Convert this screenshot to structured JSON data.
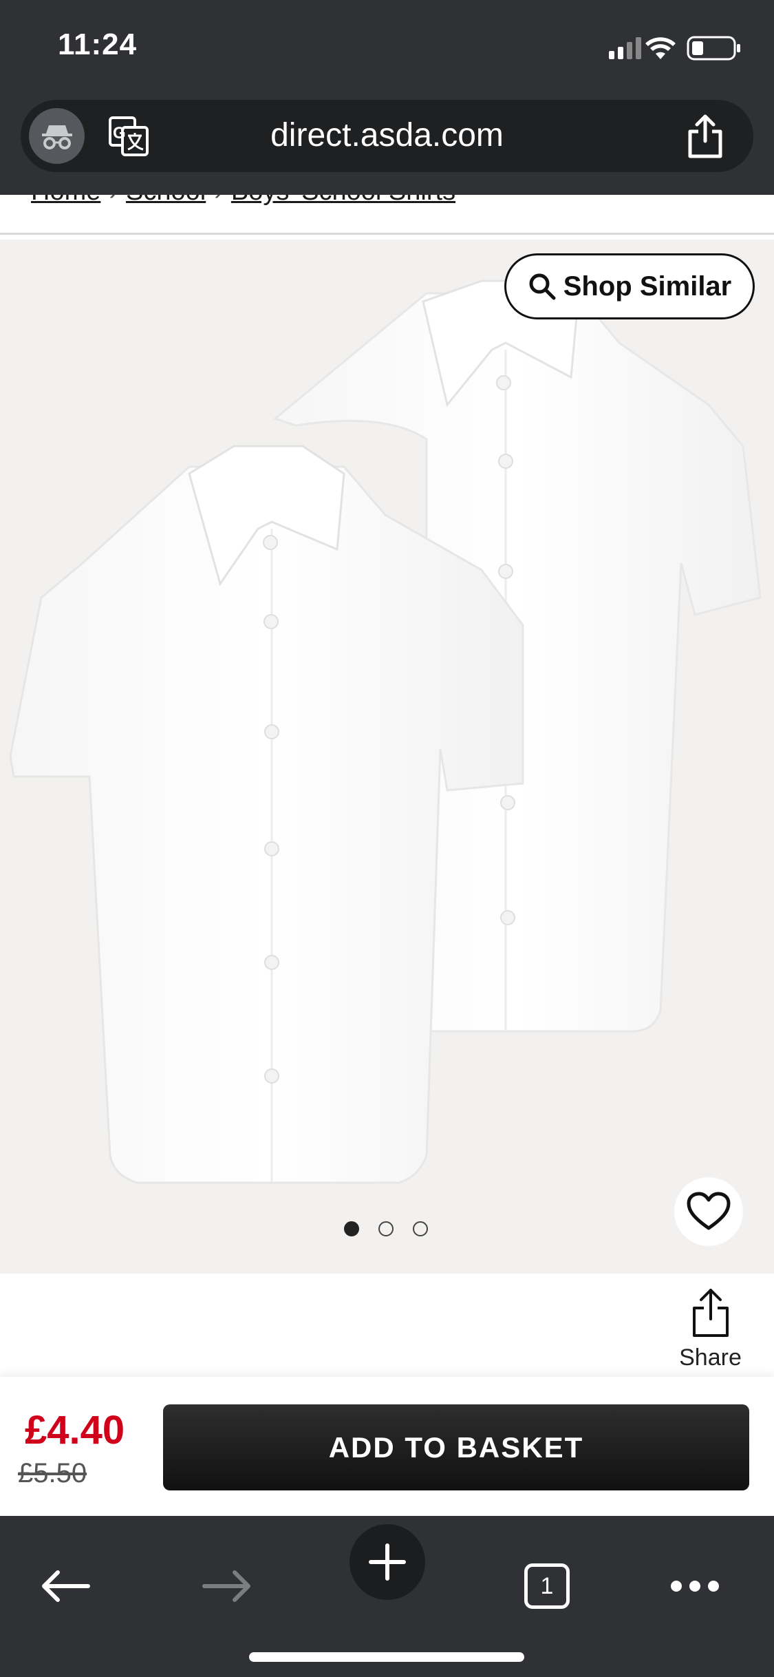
{
  "status_bar": {
    "time": "11:24"
  },
  "browser": {
    "url": "direct.asda.com"
  },
  "breadcrumb": [
    "Home",
    "School",
    "Boys' School Shirts"
  ],
  "product": {
    "shop_similar_label": "Shop Similar",
    "image_dots": {
      "count": 3,
      "active_index": 0
    },
    "share_label": "Share"
  },
  "pricing": {
    "current": "£4.40",
    "was": "£5.50"
  },
  "actions": {
    "add_to_basket": "ADD TO BASKET"
  },
  "toolbar": {
    "tab_count": "1"
  },
  "colors": {
    "price_red": "#d0021b",
    "chrome_dark": "#2f3134"
  }
}
